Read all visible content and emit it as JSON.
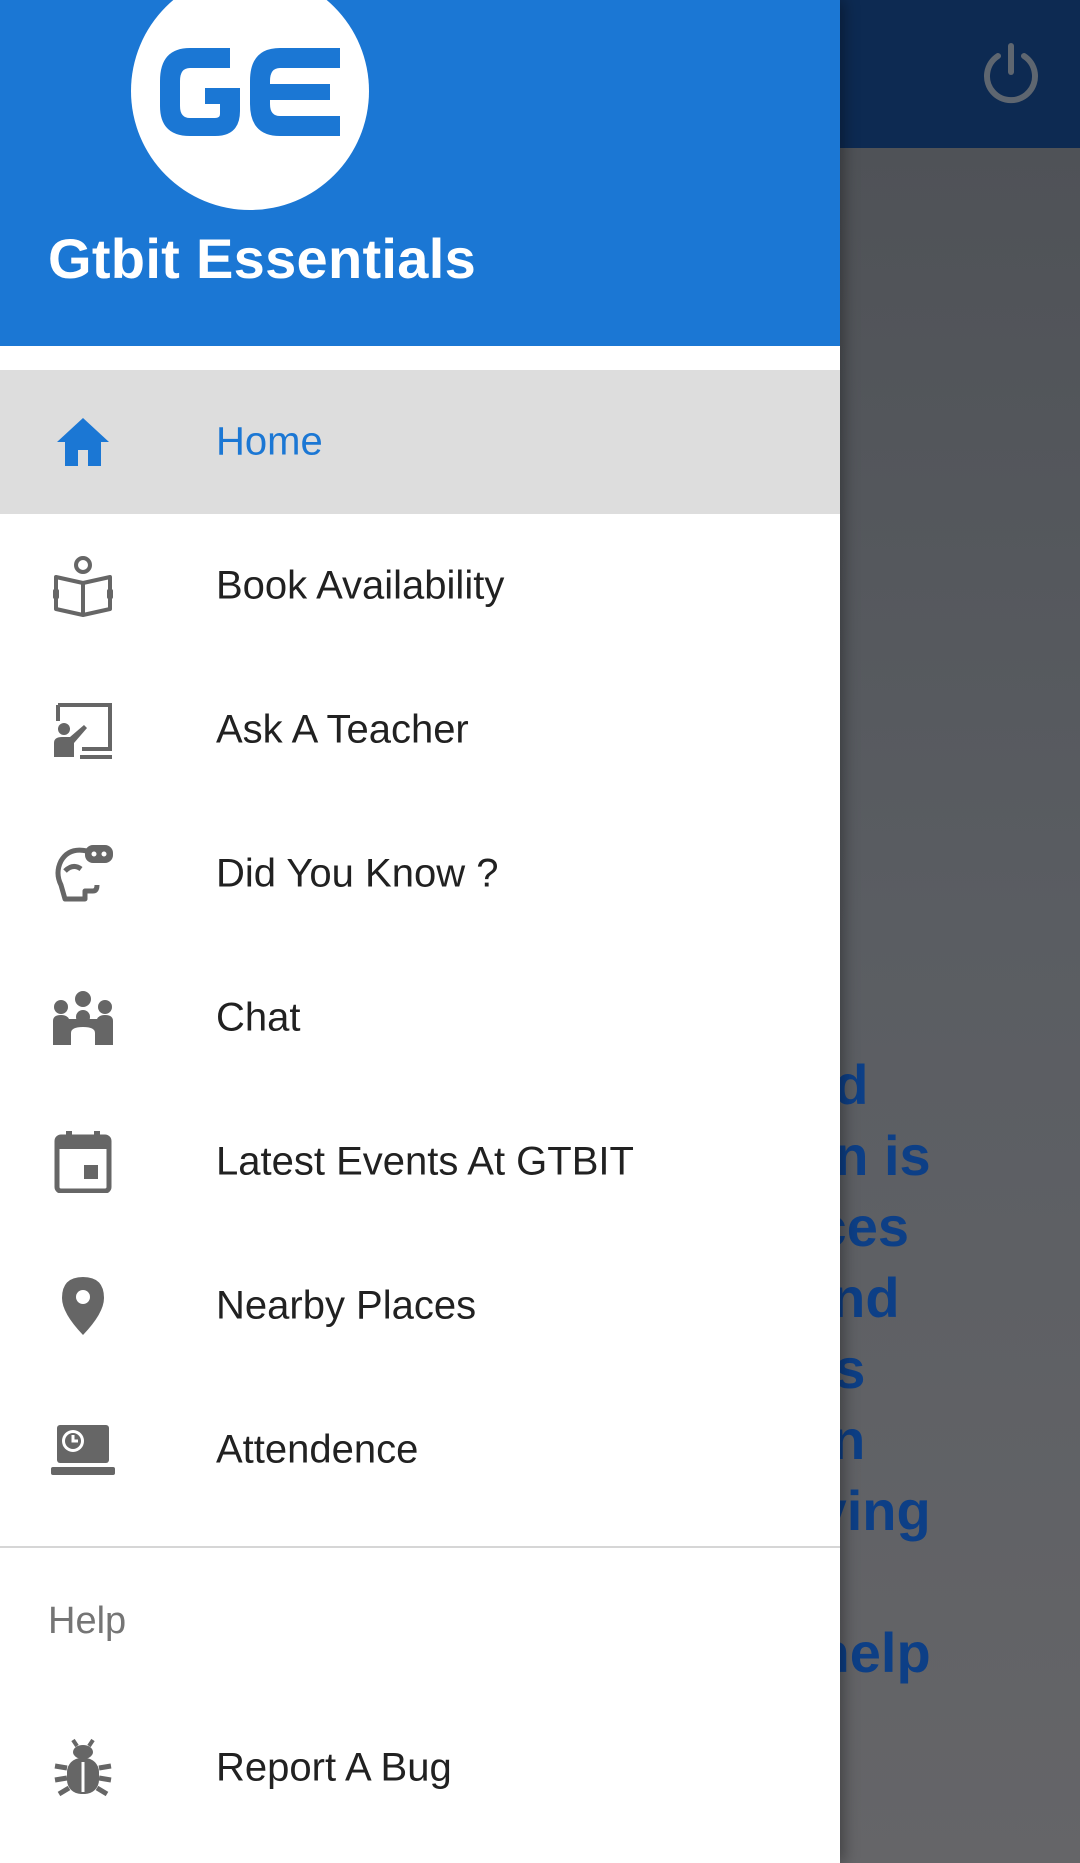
{
  "app": {
    "title": "Gtbit Essentials",
    "logo_text": "GE",
    "colors": {
      "primary": "#1b77d4",
      "appbar_dark": "#0d2a52",
      "active_bg": "#dddddd",
      "icon_grey": "#666666",
      "text": "#212121"
    }
  },
  "background": {
    "text_fragments": "o\nnd\non is\nices\nand\nus\n in\nlving\n\n help\nT.",
    "power_icon": "power-icon"
  },
  "menu": {
    "items": [
      {
        "label": "Home",
        "icon": "home-icon",
        "active": true
      },
      {
        "label": "Book Availability",
        "icon": "book-reader-icon",
        "active": false
      },
      {
        "label": "Ask A Teacher",
        "icon": "teacher-board-icon",
        "active": false
      },
      {
        "label": "Did You Know ?",
        "icon": "thinking-head-icon",
        "active": false
      },
      {
        "label": "Chat",
        "icon": "group-icon",
        "active": false
      },
      {
        "label": "Latest Events At GTBIT",
        "icon": "calendar-icon",
        "active": false
      },
      {
        "label": "Nearby Places",
        "icon": "location-pin-icon",
        "active": false
      },
      {
        "label": "Attendence",
        "icon": "laptop-clock-icon",
        "active": false
      }
    ]
  },
  "help_section": {
    "title": "Help",
    "items": [
      {
        "label": "Report A Bug",
        "icon": "bug-icon"
      }
    ]
  }
}
